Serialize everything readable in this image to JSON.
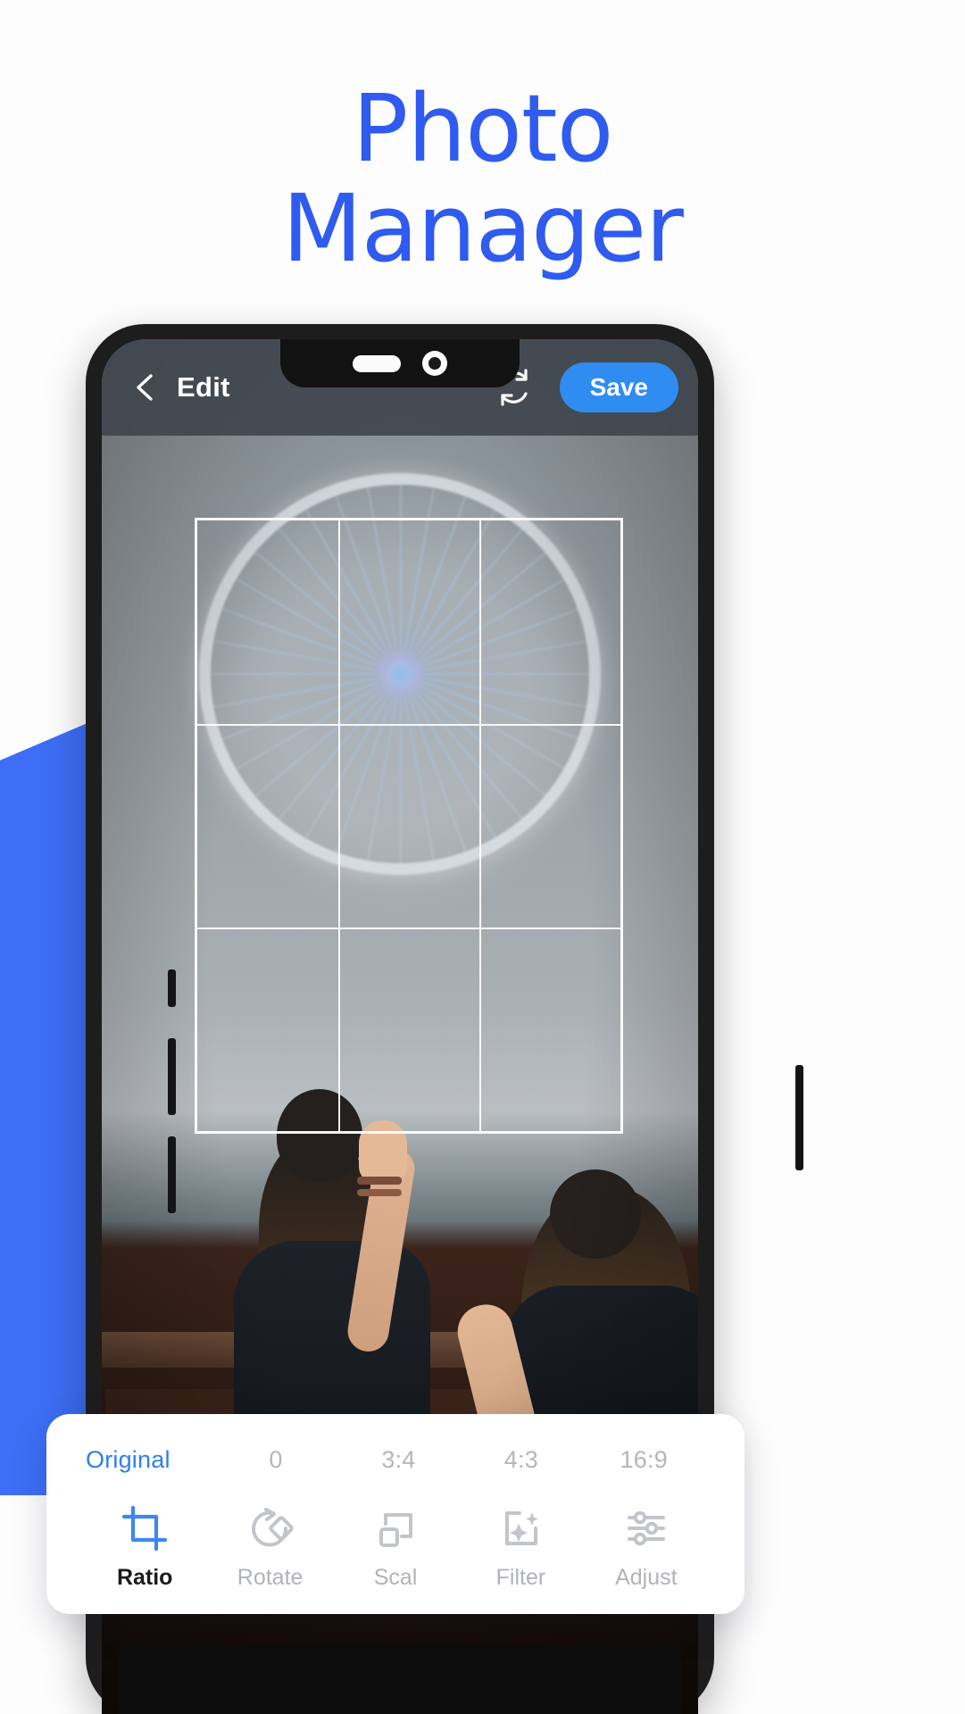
{
  "page": {
    "headline": "Photo\nManager",
    "headline_color": "#2f5bf0",
    "accent_color": "#3d6ef5"
  },
  "phone": {
    "notch": {
      "speaker_icon": "speaker-pill",
      "camera_icon": "front-camera"
    }
  },
  "appbar": {
    "back_icon": "chevron-left-icon",
    "title": "Edit",
    "sync_icon": "refresh-icon",
    "save_label": "Save",
    "save_color": "#2f8cf0"
  },
  "editor": {
    "crop_grid": "rule-of-thirds-grid"
  },
  "panel": {
    "ratios": [
      {
        "label": "Original",
        "active": true
      },
      {
        "label": "0",
        "active": false
      },
      {
        "label": "3:4",
        "active": false
      },
      {
        "label": "4:3",
        "active": false
      },
      {
        "label": "16:9",
        "active": false
      }
    ],
    "tools": [
      {
        "label": "Ratio",
        "icon": "crop-icon",
        "active": true
      },
      {
        "label": "Rotate",
        "icon": "rotate-icon",
        "active": false
      },
      {
        "label": "Scal",
        "icon": "scale-icon",
        "active": false
      },
      {
        "label": "Filter",
        "icon": "sparkle-icon",
        "active": false
      },
      {
        "label": "Adjust",
        "icon": "sliders-icon",
        "active": false
      }
    ],
    "active_color": "#2f7df0",
    "inactive_color": "#b0b3b8"
  }
}
